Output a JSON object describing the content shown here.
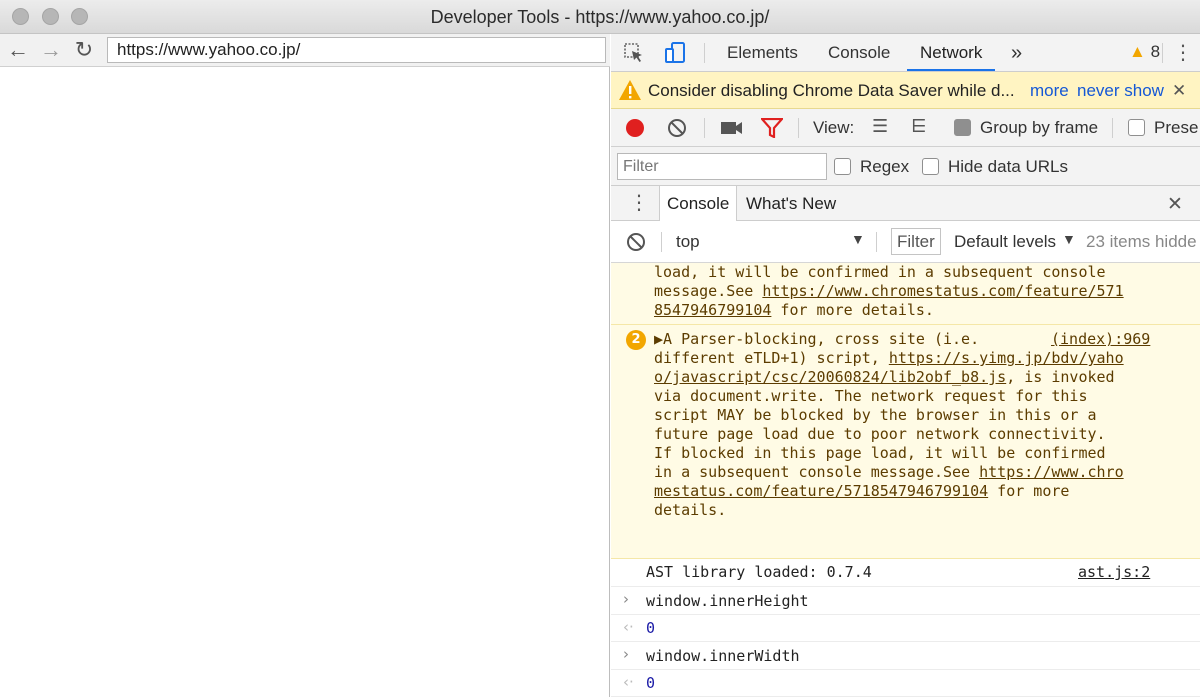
{
  "window": {
    "title": "Developer Tools - https://www.yahoo.co.jp/"
  },
  "browser": {
    "url": "https://www.yahoo.co.jp/"
  },
  "devtools": {
    "tabs": [
      "Elements",
      "Console",
      "Network"
    ],
    "more_tabs": "»",
    "warning_count": "8",
    "banner": {
      "text": "Consider disabling Chrome Data Saver while d...",
      "more": "more",
      "never_show": "never show",
      "close": "✕"
    },
    "network_toolbar": {
      "view_label": "View:",
      "group_by_frame": "Group by frame",
      "preserve": "Prese"
    },
    "filter_bar": {
      "placeholder": "Filter",
      "regex": "Regex",
      "hide_data_urls": "Hide data URLs"
    },
    "drawer": {
      "tabs": [
        "Console",
        "What's New"
      ],
      "close": "✕"
    },
    "console_bar": {
      "context": "top",
      "filter": "Filter",
      "levels": "Default levels",
      "hidden": "23 items hidde"
    },
    "messages": {
      "warn1": {
        "lines": [
          "load, it will be confirmed in a subsequent console",
          "message.See "
        ],
        "link_a": "https://www.chromestatus.com/feature/571",
        "link_b": "8547946799104",
        "tail": " for more details."
      },
      "warn2": {
        "count": "2",
        "line1": "▶A Parser-blocking, cross site (i.e.",
        "source": "(index):969",
        "line2_pre": "different eTLD+1) script, ",
        "link1_a": "https://s.yimg.jp/bdv/yaho",
        "link1_b": "o/javascript/csc/20060824/lib2obf_b8.js",
        "line3_post": ", is invoked",
        "body": [
          "via document.write. The network request for this",
          "script MAY be blocked by the browser in this or a",
          "future page load due to poor network connectivity.",
          "If blocked in this page load, it will be confirmed"
        ],
        "line8_pre": "in a subsequent console message.See ",
        "link2_a": "https://www.chro",
        "link2_b": "mestatus.com/feature/5718547946799104",
        "line9_post": " for more",
        "line10": "details."
      },
      "log": {
        "text": "AST library loaded: 0.7.4",
        "source": "ast.js:2"
      },
      "cmd1": "window.innerHeight",
      "res1": "0",
      "cmd2": "window.innerWidth",
      "res2": "0"
    }
  }
}
